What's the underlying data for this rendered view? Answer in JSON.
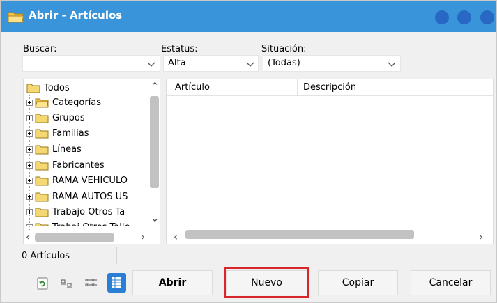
{
  "window": {
    "title": "Abrir - Artículos"
  },
  "filters": {
    "buscar": {
      "label": "Buscar:",
      "value": ""
    },
    "estatus": {
      "label": "Estatus:",
      "value": "Alta"
    },
    "situacion": {
      "label": "Situación:",
      "value": "(Todas)"
    }
  },
  "tree": {
    "root": "Todos",
    "items": [
      {
        "label": "Categorías",
        "icon": "folder-open-icon"
      },
      {
        "label": "Grupos",
        "icon": "folder-icon"
      },
      {
        "label": "Familias",
        "icon": "folder-icon"
      },
      {
        "label": "Líneas",
        "icon": "folder-icon"
      },
      {
        "label": "Fabricantes",
        "icon": "folder-icon"
      },
      {
        "label": "RAMA VEHICULO",
        "icon": "folder-icon"
      },
      {
        "label": "RAMA AUTOS US",
        "icon": "folder-icon"
      },
      {
        "label": "Trabajo Otros Ta",
        "icon": "folder-icon"
      },
      {
        "label": "Trabaj Otros Talle",
        "icon": "folder-icon"
      }
    ]
  },
  "grid": {
    "columns": [
      "Artículo",
      "Descripción"
    ],
    "rows": []
  },
  "status": {
    "text": "0 Artículos"
  },
  "toolbar": {
    "buttons": {
      "abrir": "Abrir",
      "nuevo": "Nuevo",
      "copiar": "Copiar",
      "cancelar": "Cancelar"
    },
    "icons": [
      "refresh-icon",
      "small-icons-view-icon",
      "list-view-icon",
      "details-view-icon"
    ]
  },
  "colors": {
    "titlebar": "#3a94d9",
    "highlight": "#d9262a",
    "selected_view": "#2a7fd4"
  }
}
